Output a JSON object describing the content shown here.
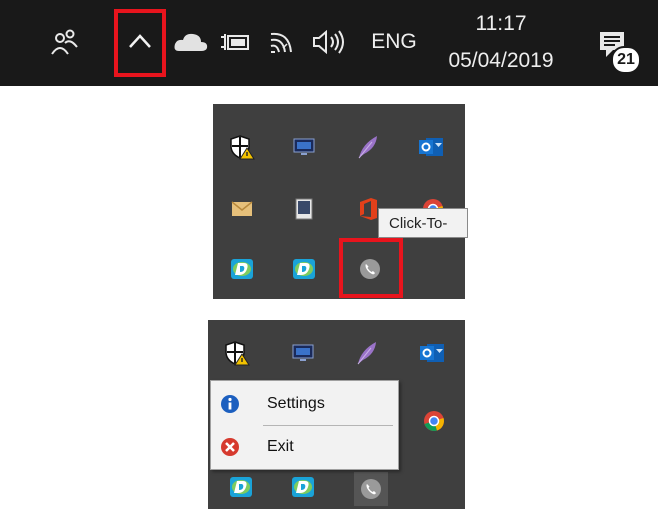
{
  "taskbar": {
    "language": "ENG",
    "time": "11:17",
    "date": "05/04/2019",
    "notification_count": "21"
  },
  "icons": {
    "people": "people-icon",
    "show_hidden": "chevron-up-icon",
    "onedrive": "cloud-icon",
    "power": "battery-plug-icon",
    "network": "wifi-icon",
    "volume": "speaker-icon",
    "action_center": "notification-icon"
  },
  "tray_icons": [
    "defender-shield-icon",
    "monitor-icon",
    "feather-icon",
    "outlook-icon",
    "mail-envelope-icon",
    "tablet-icon",
    "office-icon",
    "chrome-icon",
    "dell-icon",
    "dell-icon",
    "phone-icon"
  ],
  "tooltip": {
    "text": "Click-To-"
  },
  "context_menu": {
    "items": [
      {
        "label": "Settings",
        "icon": "info-icon"
      },
      {
        "label": "Exit",
        "icon": "exit-icon"
      }
    ]
  },
  "colors": {
    "taskbar_bg": "#191919",
    "tray_bg": "#3f3f3f",
    "highlight": "#e8141d",
    "menu_bg": "#f2f2f2"
  }
}
